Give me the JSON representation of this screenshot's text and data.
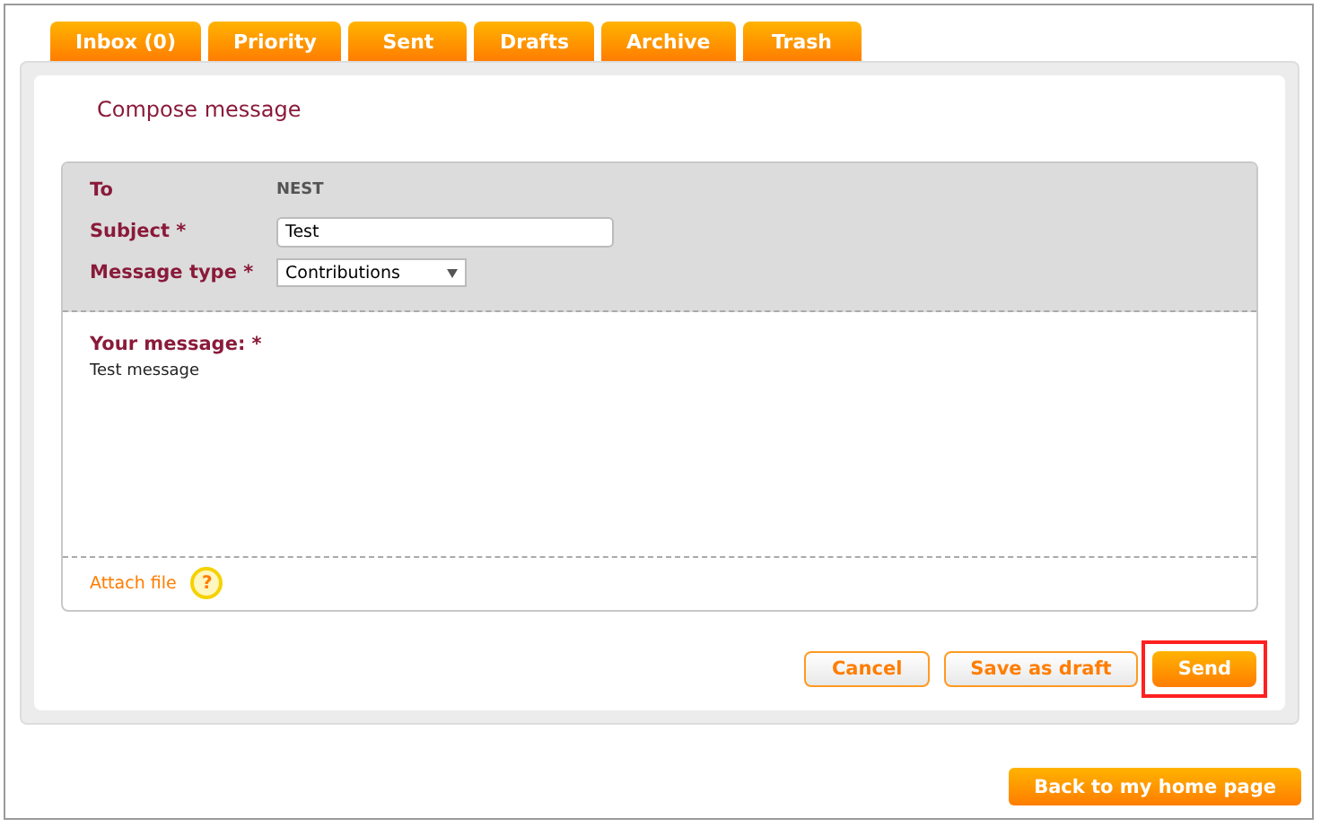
{
  "tabs": [
    {
      "label": "Inbox (0)"
    },
    {
      "label": "Priority"
    },
    {
      "label": "Sent"
    },
    {
      "label": "Drafts"
    },
    {
      "label": "Archive"
    },
    {
      "label": "Trash"
    }
  ],
  "title": "Compose message",
  "fields": [
    {
      "kind": "static",
      "label": "To",
      "value": "NEST"
    },
    {
      "kind": "text",
      "label": "Subject *",
      "value": "Test"
    },
    {
      "kind": "select",
      "label": "Message type *",
      "value": "Contributions"
    }
  ],
  "message": {
    "label": "Your message: *",
    "value": "Test message"
  },
  "attach": {
    "label": "Attach file",
    "help": "?"
  },
  "buttons": [
    {
      "label": "Cancel",
      "kind": "secondary",
      "highlighted": false
    },
    {
      "label": "Save as draft",
      "kind": "secondary",
      "highlighted": false
    },
    {
      "label": "Send",
      "kind": "primary",
      "highlighted": true
    }
  ],
  "home_button": "Back to my home page"
}
